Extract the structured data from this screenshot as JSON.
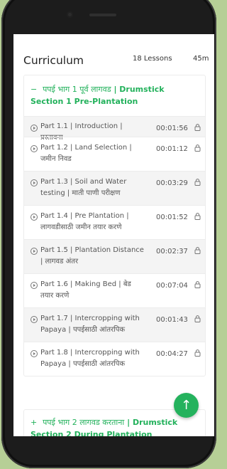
{
  "curriculum": {
    "title": "Curriculum",
    "lessons_count": "18 Lessons",
    "total_duration": "45m"
  },
  "sections": [
    {
      "toggle": "−",
      "title_mr": "पपई भाग 1 पूर्व लागवड",
      "title_en": "| Drumstick Section 1 Pre-Plantation",
      "lessons": [
        {
          "label": "Part 1.1 | Introduction | प्रस्तावना",
          "duration": "00:01:56"
        },
        {
          "label": "Part 1.2 | Land Selection | जमीन निवड",
          "duration": "00:01:12"
        },
        {
          "label": "Part 1.3 | Soil and Water testing | माती पाणी परीक्षण",
          "duration": "00:03:29"
        },
        {
          "label": "Part 1.4 | Pre Plantation | लागवडीसाठी जमीन तयार करणे",
          "duration": "00:01:52"
        },
        {
          "label": "Part 1.5 | Plantation Distance | लागवड अंतर",
          "duration": "00:02:37"
        },
        {
          "label": "Part 1.6 | Making Bed | बेड तयार करणे",
          "duration": "00:07:04"
        },
        {
          "label": "Part 1.7 | Intercropping with Papaya | पपईसाठी आंतरपिक",
          "duration": "00:01:43"
        },
        {
          "label": "Part 1.8 | Intercropping with Papaya | पपईसाठी आंतरपिक",
          "duration": "00:04:27"
        }
      ]
    },
    {
      "toggle": "+",
      "title_mr": "पपई भाग 2 लागवड करताना",
      "title_en": "| Drumstick Section 2 During Plantation"
    }
  ],
  "fab": {
    "icon": "arrow-up-icon",
    "glyph": "↑"
  },
  "colors": {
    "accent": "#22b15b",
    "background": "#b6cf96",
    "shade": "#f4f4f4"
  }
}
